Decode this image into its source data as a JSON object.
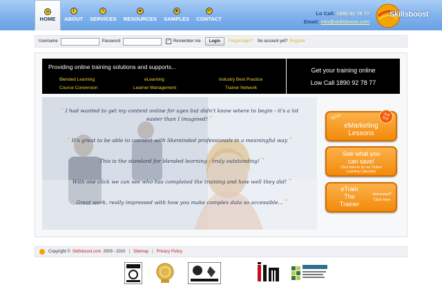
{
  "nav": {
    "items": [
      {
        "label": "HOME",
        "icon": "home-icon"
      },
      {
        "label": "ABOUT",
        "icon": "info-icon"
      },
      {
        "label": "SERVICES",
        "icon": "wrench-icon"
      },
      {
        "label": "RESOURCES",
        "icon": "folder-icon"
      },
      {
        "label": "SAMPLES",
        "icon": "eye-icon"
      },
      {
        "label": "CONTACT",
        "icon": "mail-icon"
      }
    ]
  },
  "contact": {
    "lo_call_label": "Lo Call:",
    "lo_call_value": "1890 92 78 77",
    "email_label": "Email:",
    "email_value": "info@skillsboost.com"
  },
  "brand": {
    "name": "Skillsboost"
  },
  "login": {
    "username_label": "Username",
    "password_label": "Password",
    "remember_label": "Remember me",
    "login_button": "Login",
    "forgot_link": "Forgot login?",
    "no_account": "No account yet?",
    "register_link": "Register"
  },
  "hero": {
    "title": "Providing online training solutions and supports...",
    "services": [
      "Blended Learning",
      "eLearning",
      "Industry Best Practice",
      "Course Conversion",
      "Learner Management",
      "Trainer Network"
    ],
    "cta_line1": "Get your training online",
    "cta_line2": "Low Call 1890 92 78 77"
  },
  "quotes": [
    "I had wanted to get my content online for ages but didn't know where to begin - it's a lot easier than I imagined!",
    "It's great to be able to connect with likeminded professionals in a meaningful way",
    "This is the standard for blended learning - truly outstanding!",
    "With one click we can see who has completed the training and how well they did!",
    "Great work, really impressed with how you make complex data so accessible..."
  ],
  "promos": {
    "emarketing": {
      "badge_new": "NEW!",
      "line1": "eMarketing",
      "line2": "Lessons",
      "price_line1": "Just",
      "price_line2": "€29"
    },
    "save": {
      "line1": "See what you",
      "line2": "can save!",
      "small1": "Click here to try our Online",
      "small2": "Learning Calculator"
    },
    "trainer": {
      "line1": "eTrain",
      "line2": "The",
      "line3": "Trainer",
      "side1": "Interested?",
      "side2": "Click here"
    }
  },
  "footer": {
    "copyright_prefix": "Copyright ©",
    "company": "Skillsboost.com",
    "years": "2009 - 2010",
    "sitemap": "Sitemap",
    "privacy": "Privacy Policy"
  },
  "colors": {
    "header_blue": "#7fb1ec",
    "accent_yellow": "#f0d431",
    "promo_orange": "#f38a0a",
    "link_red": "#c41a1a"
  }
}
